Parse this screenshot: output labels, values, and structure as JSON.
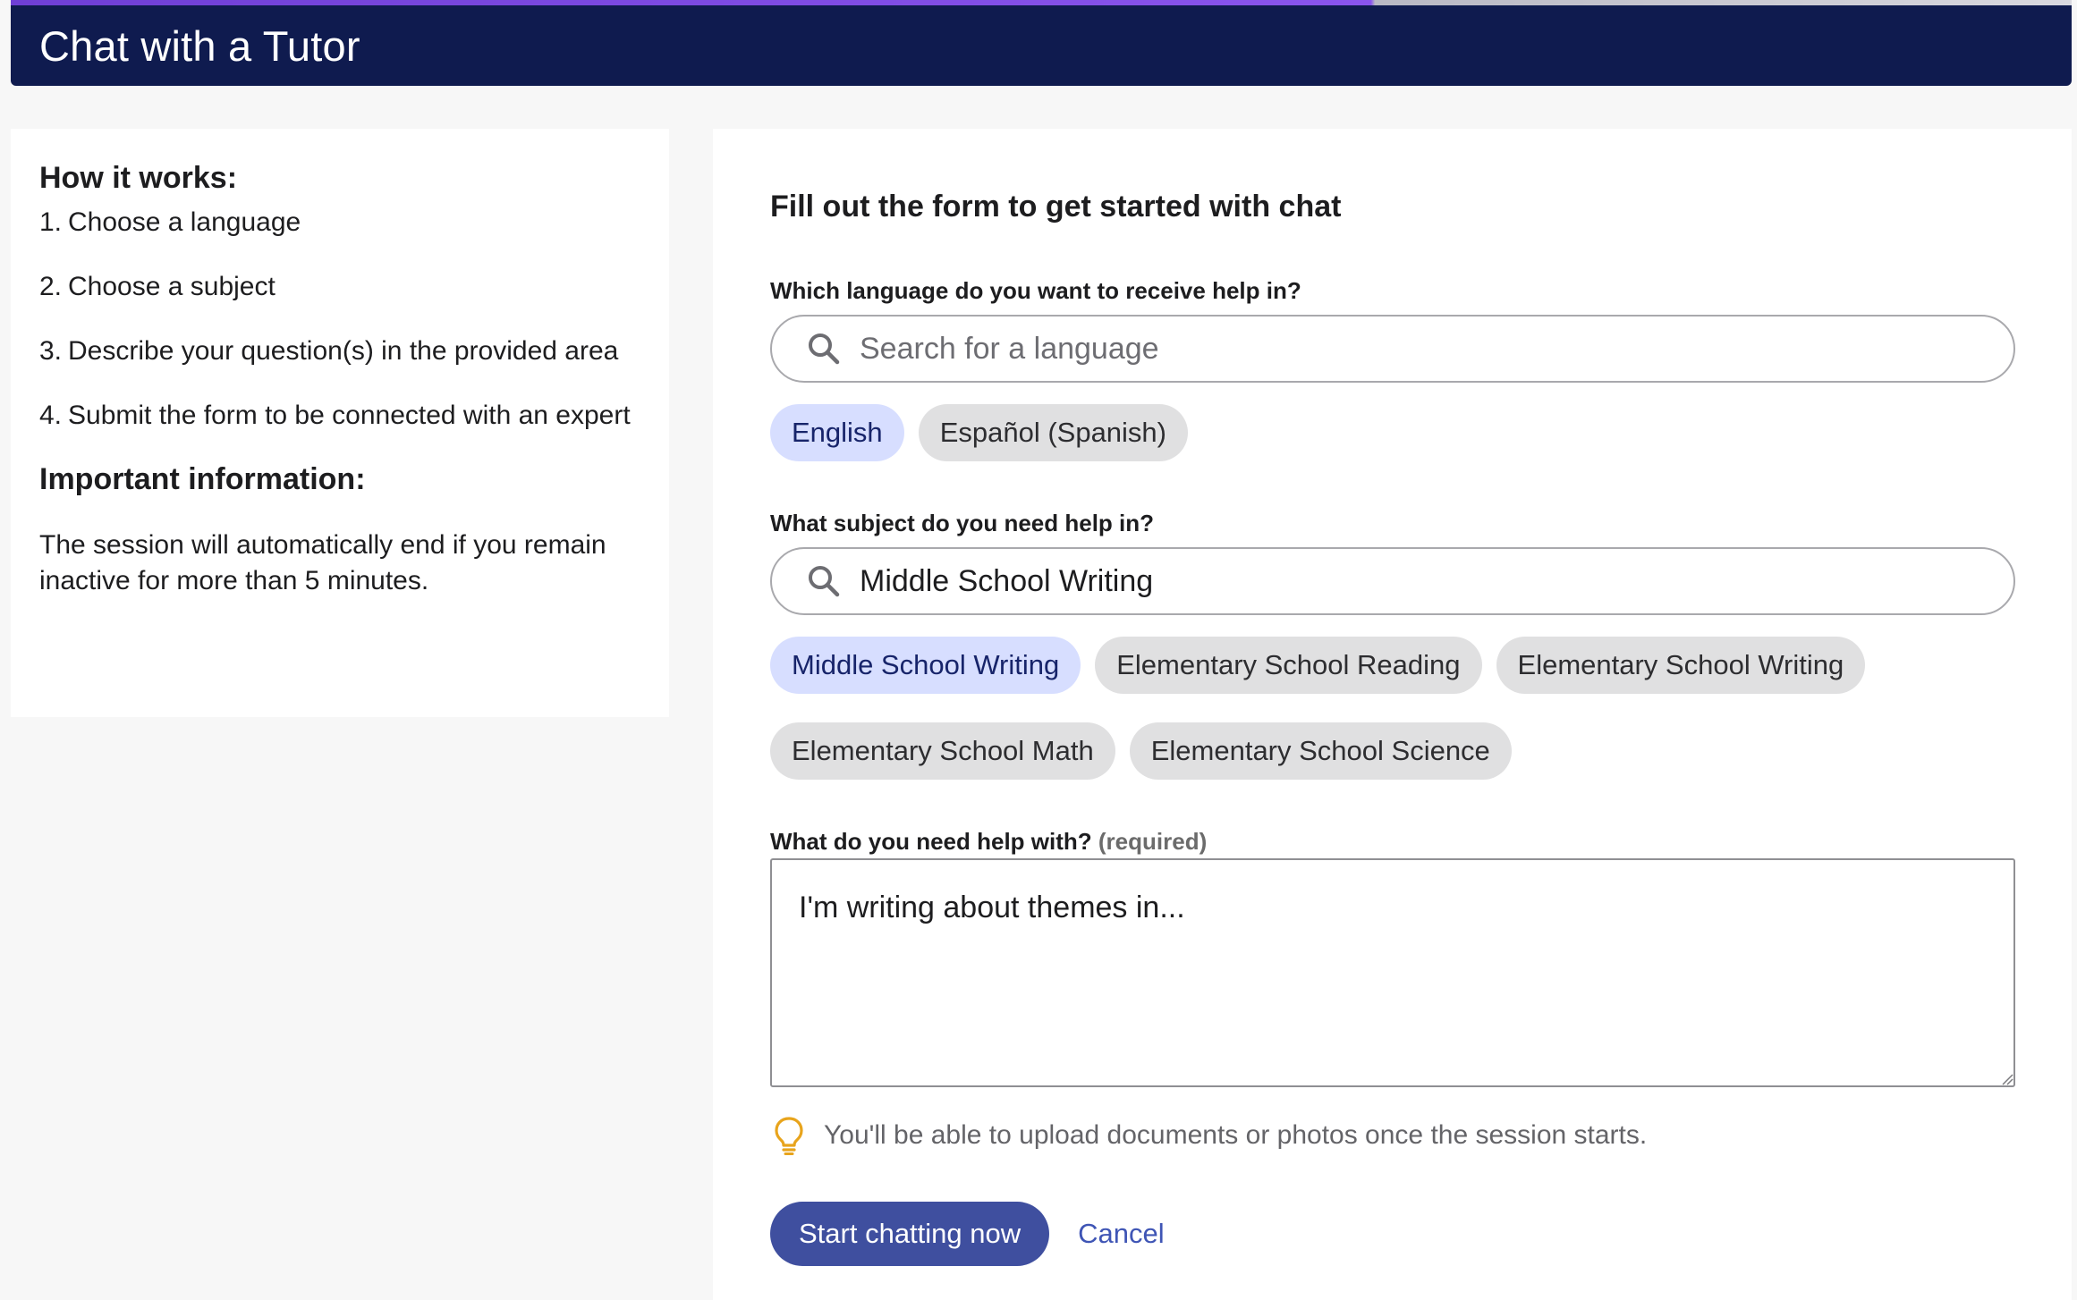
{
  "header": {
    "title": "Chat with a Tutor"
  },
  "sidebar": {
    "how_title": "How it works:",
    "steps": [
      {
        "num": "1.",
        "text": "Choose a language"
      },
      {
        "num": "2.",
        "text": "Choose a subject"
      },
      {
        "num": "3.",
        "text": "Describe your question(s) in the provided area"
      },
      {
        "num": "4.",
        "text": "Submit the form to be connected with an expert"
      }
    ],
    "important_title": "Important information:",
    "important_text": "The session will automatically end if you remain inactive for more than 5 minutes."
  },
  "form": {
    "title": "Fill out the form to get started with chat",
    "language": {
      "label": "Which language do you want to receive help in?",
      "placeholder": "Search for a language",
      "value": "",
      "options": [
        {
          "label": "English",
          "selected": true
        },
        {
          "label": "Español (Spanish)",
          "selected": false
        }
      ]
    },
    "subject": {
      "label": "What subject do you need help in?",
      "value": "Middle School Writing",
      "options_row1": [
        {
          "label": "Middle School Writing",
          "selected": true
        },
        {
          "label": "Elementary School Reading",
          "selected": false
        },
        {
          "label": "Elementary School Writing",
          "selected": false
        }
      ],
      "options_row2": [
        {
          "label": "Elementary School Math",
          "selected": false
        },
        {
          "label": "Elementary School Science",
          "selected": false
        }
      ]
    },
    "question": {
      "label": "What do you need help with?",
      "required_tag": "(required)",
      "value": "I'm writing about themes in..."
    },
    "hint": "You'll be able to upload documents or photos once the session starts.",
    "submit_label": "Start chatting now",
    "cancel_label": "Cancel"
  },
  "colors": {
    "header_bg": "#0f1b4f",
    "primary": "#3f4f9f",
    "chip_selected": "#d7deff",
    "chip_default": "#e0e0e1",
    "link": "#3f55b5",
    "bulb": "#e8a41c"
  },
  "icons": {
    "search": "search-icon",
    "hint": "lightbulb-icon",
    "resize": "resize-grip-icon"
  }
}
